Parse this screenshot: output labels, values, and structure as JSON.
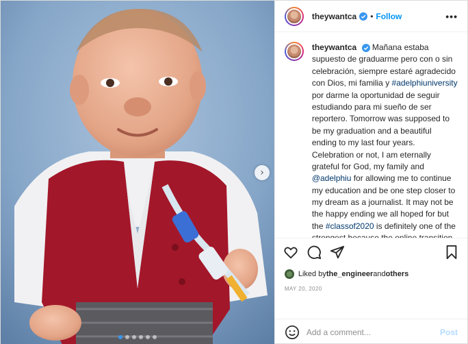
{
  "post": {
    "username": "theywantca",
    "separator": "•",
    "follow_label": "Follow",
    "more_label": "•••",
    "caption_parts": {
      "p1": " Mañana estaba supuesto de graduarme pero con o sin celebración, siempre estaré agradecido con Dios, mi familia y ",
      "tag1": "#adelphiuniversity",
      "p2": " por darme la oportunidad de seguir estudiando para mi sueño de ser reportero. Tomorrow was supposed to be my graduation and a beautiful ending to my last four years. Celebration or not, I am eternally grateful for God, my family and ",
      "tag2": "@adelphiu",
      "p3": " for allowing me to continue my education and be one step closer to my dream as a journalist. It may not be the happy ending we all hoped for but the ",
      "tag3": "#classof2020",
      "p4": " is definitely one of the strongest because the online transition is not easy at all and we all did it! Congratulations to all of you, to me and everybody who has been able to"
    },
    "likes": {
      "prefix": "Liked by ",
      "liker": "the_engineer",
      "middle": " and ",
      "others": "others"
    },
    "date": "MAY 20, 2020",
    "comment": {
      "placeholder": "Add a comment...",
      "post_label": "Post"
    },
    "carousel": {
      "total_slides": 6,
      "active_slide": 1
    },
    "colors": {
      "accent": "#0095f6",
      "verified": "#3897f0",
      "post_disabled": "#b3dbff",
      "hashtag": "#00376b"
    },
    "icons": [
      "verified-badge-icon",
      "more-options-icon",
      "heart-icon",
      "comment-icon",
      "share-icon",
      "bookmark-icon",
      "emoji-icon",
      "chevron-right-icon"
    ]
  }
}
